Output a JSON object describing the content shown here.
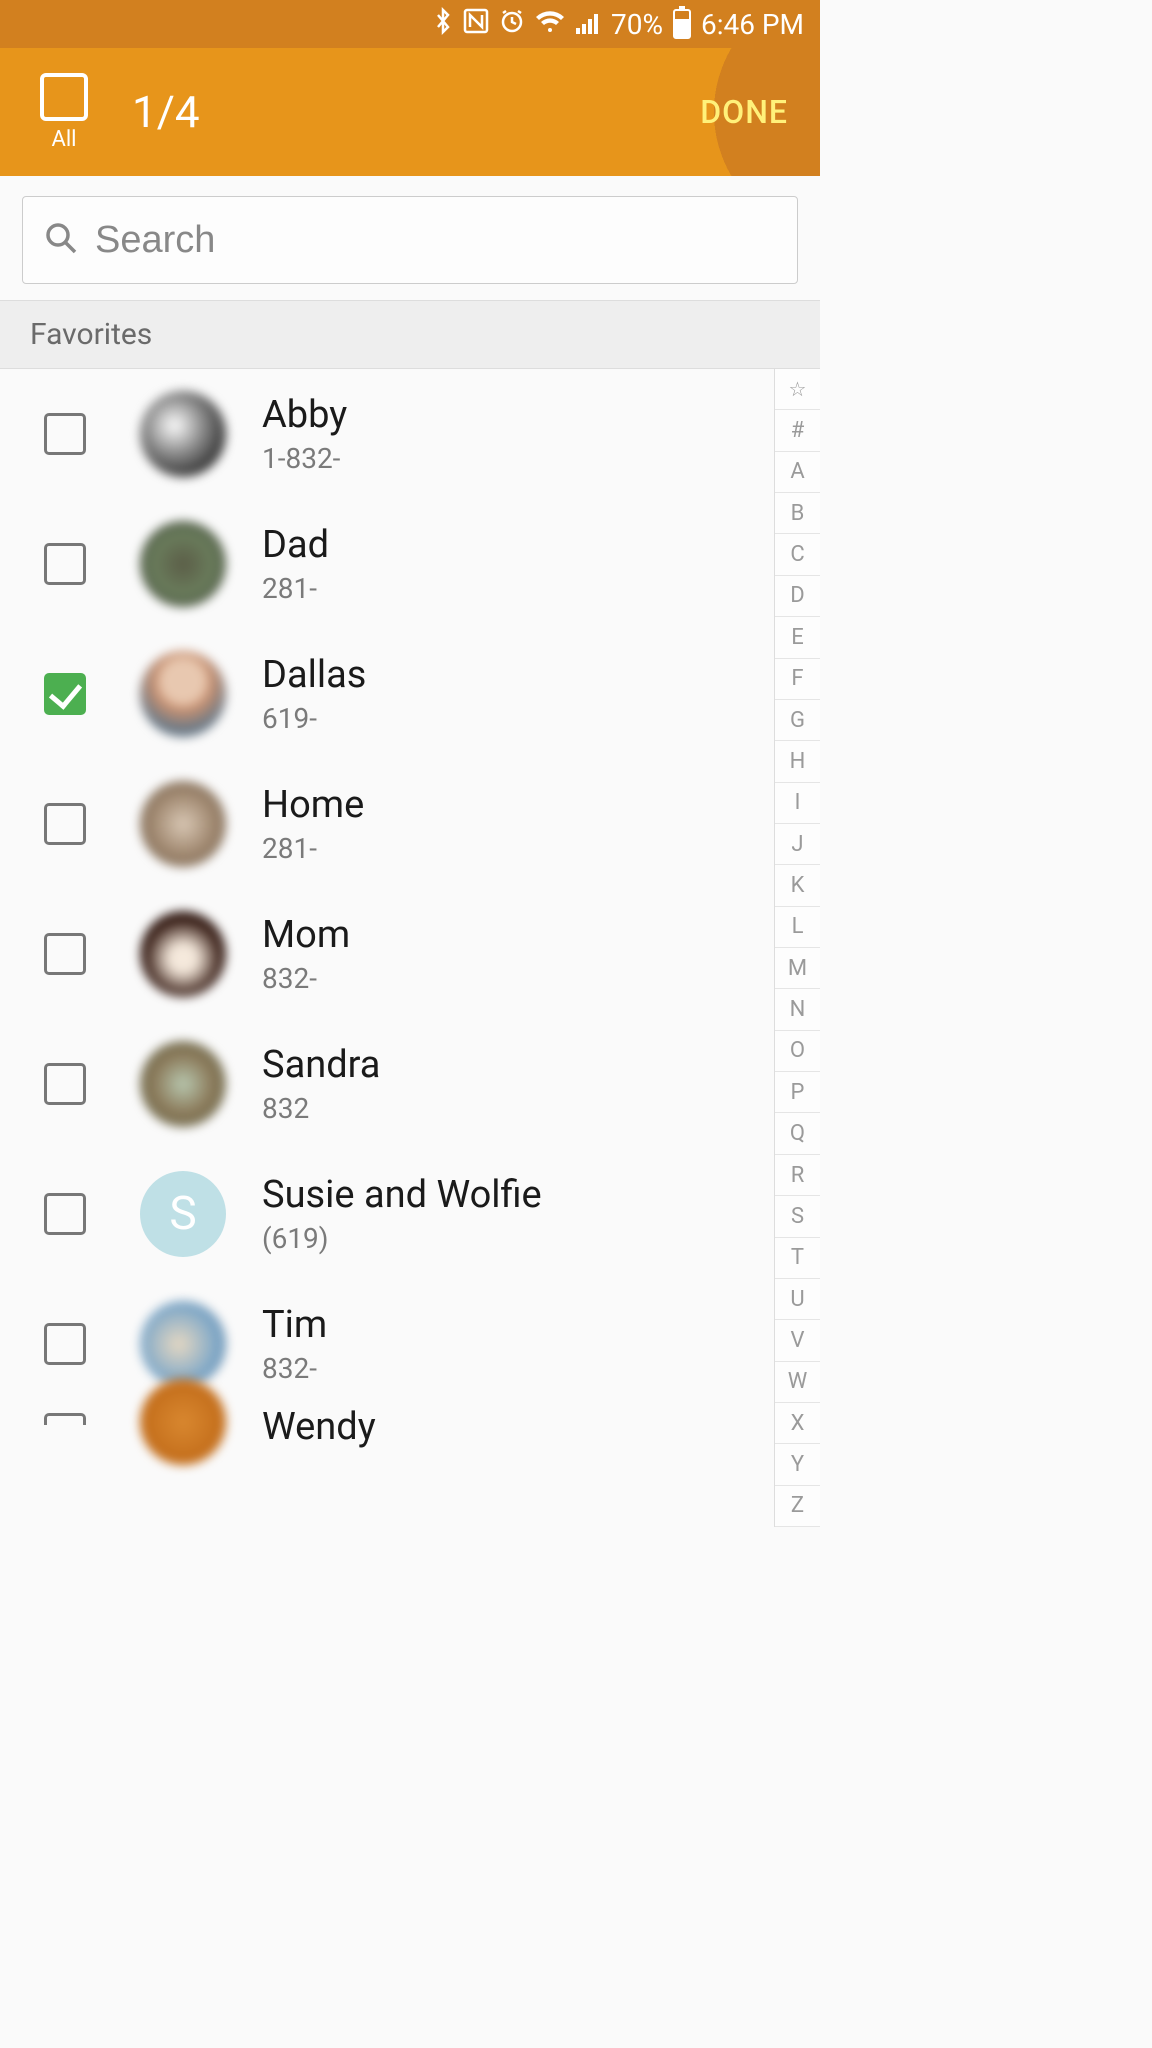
{
  "status_bar": {
    "battery_pct": "70%",
    "time": "6:46 PM"
  },
  "header": {
    "all_label": "All",
    "counter": "1/4",
    "done_label": "DONE"
  },
  "search": {
    "placeholder": "Search"
  },
  "section_label": "Favorites",
  "contacts": [
    {
      "name": "Abby",
      "phone": "1-832-",
      "checked": false,
      "avatar_bg": "radial-gradient(circle at 40% 40%, #fff, #888 40%, #222 80%)"
    },
    {
      "name": "Dad",
      "phone": "281-",
      "checked": false,
      "avatar_bg": "radial-gradient(circle at 50% 50%, #5b5d47, #6a7d5c, #2e2e2a)"
    },
    {
      "name": "Dallas",
      "phone": "619-",
      "checked": true,
      "avatar_bg": "radial-gradient(circle at 50% 35%, #e8c8b0 30%, #c89070 40%, #6a7a88 70%)"
    },
    {
      "name": "Home",
      "phone": "281-",
      "checked": false,
      "avatar_bg": "radial-gradient(circle at 50% 50%, #d9c8b5, #a08870, #6b5a48)"
    },
    {
      "name": "Mom",
      "phone": "832-",
      "checked": false,
      "avatar_bg": "radial-gradient(circle at 50% 55%, #f5e9dc 20%, #3a2018 60%, #1a0c08)"
    },
    {
      "name": "Sandra",
      "phone": "832",
      "checked": false,
      "avatar_bg": "radial-gradient(circle at 50% 50%, #b8c8b0, #8a7858, #5a6850)"
    },
    {
      "name": "Susie and Wolfie",
      "phone": "(619)",
      "checked": false,
      "avatar_bg": "#bfe0e6",
      "letter": "S"
    },
    {
      "name": "Tim",
      "phone": "832-",
      "checked": false,
      "avatar_bg": "radial-gradient(circle at 45% 50%, #e6d8c2, #7fa8c8 60%, #4a6a88)"
    },
    {
      "name": "Wendy",
      "phone": "",
      "checked": false,
      "avatar_bg": "radial-gradient(circle at 50% 50%, #d98830, #b86010)",
      "partial": true
    }
  ],
  "index_strip": [
    "☆",
    "#",
    "A",
    "B",
    "C",
    "D",
    "E",
    "F",
    "G",
    "H",
    "I",
    "J",
    "K",
    "L",
    "M",
    "N",
    "O",
    "P",
    "Q",
    "R",
    "S",
    "T",
    "U",
    "V",
    "W",
    "X",
    "Y",
    "Z"
  ]
}
